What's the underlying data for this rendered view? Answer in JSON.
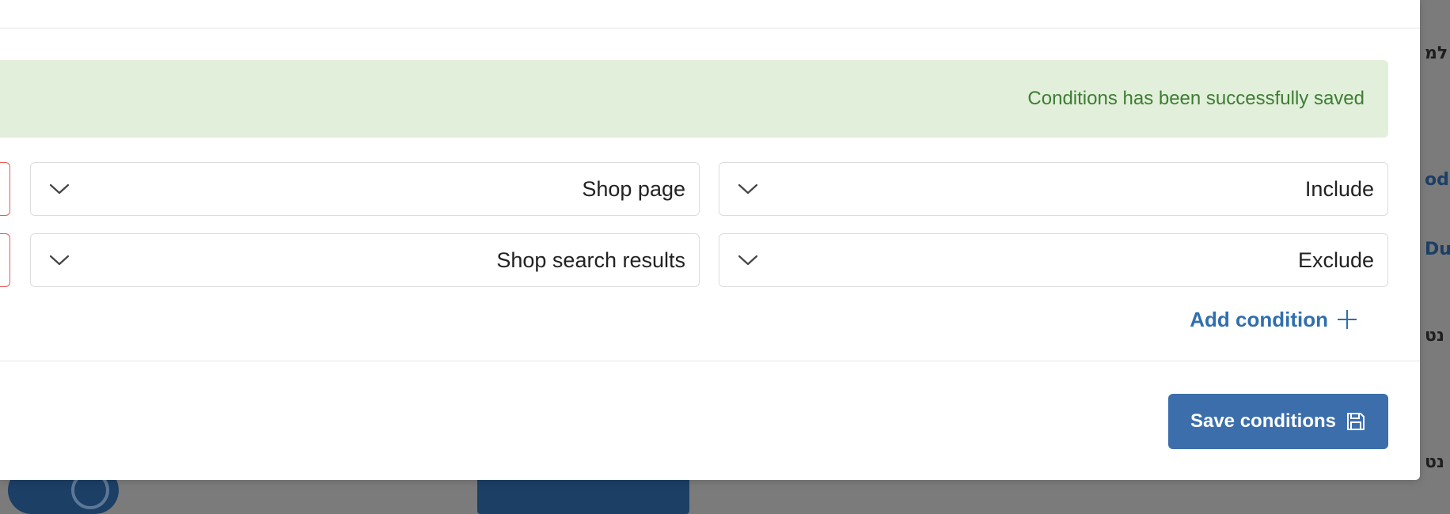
{
  "background": {
    "side_texts": [
      "למ",
      "od",
      "Du",
      "נט",
      "נט"
    ]
  },
  "alert": {
    "message": "Conditions has been successfully saved"
  },
  "conditions": [
    {
      "type": "Include",
      "target": "Shop page"
    },
    {
      "type": "Exclude",
      "target": "Shop search results"
    }
  ],
  "actions": {
    "add_condition_label": "Add condition",
    "save_label": "Save conditions"
  },
  "icons": {
    "chevron": "chevron-down-icon",
    "plus": "plus-icon",
    "save": "save-icon"
  },
  "colors": {
    "alert_bg": "#e2efdb",
    "alert_text": "#3d7d33",
    "link": "#2f6fad",
    "primary_button": "#3c6eac",
    "danger_border": "#e35b5b"
  }
}
